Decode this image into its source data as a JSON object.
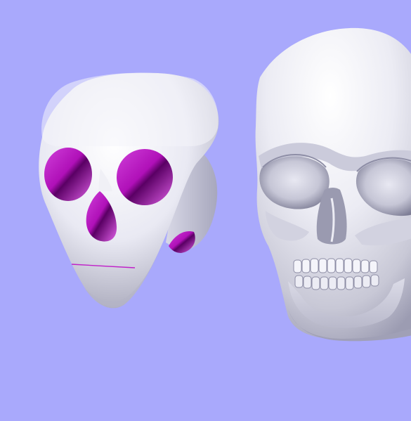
{
  "scene": {
    "background_color": "#a9a9fc",
    "objects": [
      {
        "name": "simplified-skull-model",
        "body_color": "#e6e6f0",
        "cavity_color": "#c020c8"
      },
      {
        "name": "detailed-skull-model",
        "body_color": "#e4e4ee"
      }
    ]
  }
}
